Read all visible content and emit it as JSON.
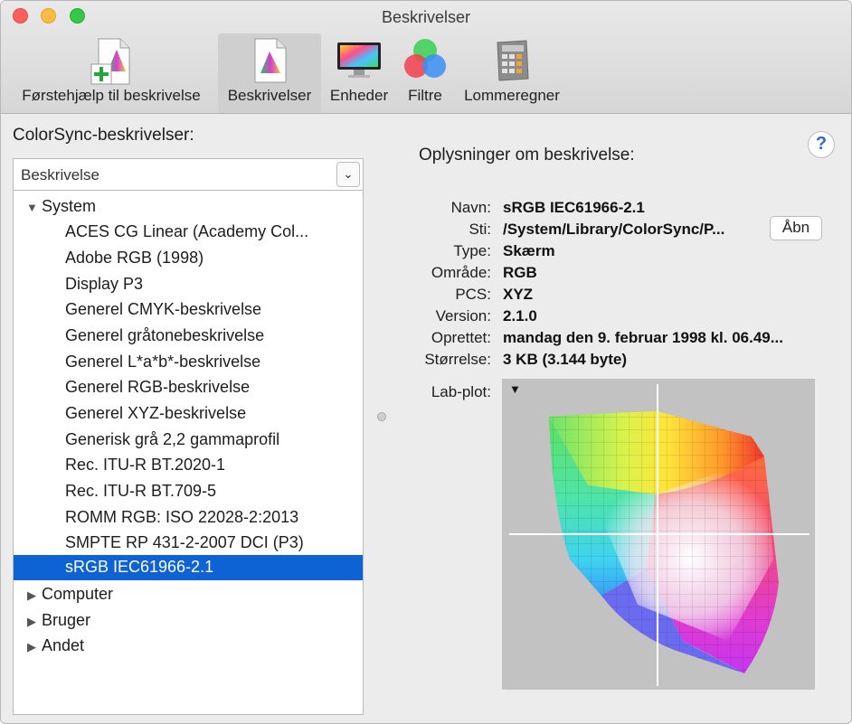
{
  "window": {
    "title": "Beskrivelser"
  },
  "toolbar": {
    "items": [
      {
        "label": "Førstehjælp til beskrivelse",
        "icon": "first-aid-profile-icon"
      },
      {
        "label": "Beskrivelser",
        "icon": "profiles-icon",
        "selected": true
      },
      {
        "label": "Enheder",
        "icon": "display-icon"
      },
      {
        "label": "Filtre",
        "icon": "filters-icon"
      },
      {
        "label": "Lommeregner",
        "icon": "calculator-icon"
      }
    ]
  },
  "left": {
    "title": "ColorSync-beskrivelser:",
    "select_value": "Beskrivelse",
    "groups": [
      {
        "label": "System",
        "expanded": true,
        "items": [
          "ACES CG Linear (Academy Col...",
          "Adobe RGB (1998)",
          "Display P3",
          "Generel CMYK-beskrivelse",
          "Generel gråtonebeskrivelse",
          "Generel L*a*b*-beskrivelse",
          "Generel RGB-beskrivelse",
          "Generel XYZ-beskrivelse",
          "Generisk grå 2,2 gammaprofil",
          "Rec. ITU-R BT.2020-1",
          "Rec. ITU-R BT.709-5",
          "ROMM RGB: ISO 22028-2:2013",
          "SMPTE RP 431-2-2007 DCI (P3)",
          "sRGB IEC61966-2.1"
        ],
        "selected_index": 13
      },
      {
        "label": "Computer",
        "expanded": false
      },
      {
        "label": "Bruger",
        "expanded": false
      },
      {
        "label": "Andet",
        "expanded": false
      }
    ]
  },
  "right": {
    "help_glyph": "?",
    "title": "Oplysninger om beskrivelse:",
    "fields": [
      {
        "label": "Navn:",
        "value": "sRGB IEC61966-2.1"
      },
      {
        "label": "Sti:",
        "value": "/System/Library/ColorSync/P..."
      },
      {
        "label": "Type:",
        "value": "Skærm"
      },
      {
        "label": "Område:",
        "value": "RGB"
      },
      {
        "label": "PCS:",
        "value": "XYZ"
      },
      {
        "label": "Version:",
        "value": "2.1.0"
      },
      {
        "label": "Oprettet:",
        "value": "mandag den 9. februar 1998 kl. 06.49..."
      },
      {
        "label": "Størrelse:",
        "value": "3 KB (3.144 byte)"
      }
    ],
    "open_button": "Åbn",
    "plot_label": "Lab-plot:"
  },
  "colors": {
    "selection": "#0f62d4",
    "accent": "#2a6ad8"
  }
}
